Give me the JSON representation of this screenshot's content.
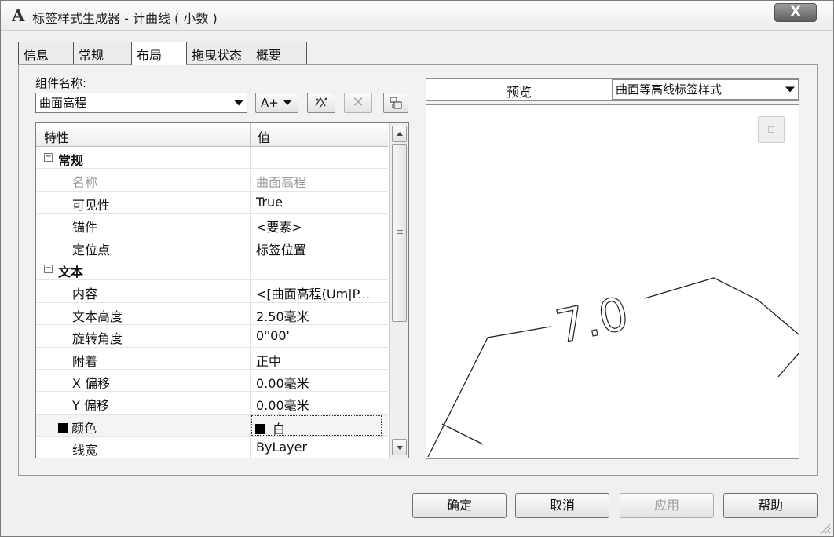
{
  "window": {
    "title": "标签样式生成器 - 计曲线 ( 小数 )",
    "close_label": "X"
  },
  "tabs": [
    {
      "label": "信息"
    },
    {
      "label": "常规"
    },
    {
      "label": "布局",
      "active": true
    },
    {
      "label": "拖曳状态"
    },
    {
      "label": "概要"
    }
  ],
  "component": {
    "label": "组件名称:",
    "selected": "曲面高程",
    "add_component_label": "A+"
  },
  "grid": {
    "headers": {
      "property": "特性",
      "value": "值"
    },
    "categories": {
      "general": "常规",
      "text": "文本"
    },
    "rows": [
      {
        "name": "名称",
        "value": "曲面高程"
      },
      {
        "name": "可见性",
        "value": "True"
      },
      {
        "name": "锚件",
        "value": "<要素>"
      },
      {
        "name": "定位点",
        "value": "标签位置"
      },
      {
        "name": "内容",
        "value": "<[曲面高程(Um|P..."
      },
      {
        "name": "文本高度",
        "value": "2.50毫米"
      },
      {
        "name": "旋转角度",
        "value": "0°00'"
      },
      {
        "name": "附着",
        "value": "正中"
      },
      {
        "name": "X 偏移",
        "value": "0.00毫米"
      },
      {
        "name": "Y 偏移",
        "value": "0.00毫米"
      },
      {
        "name": "颜色",
        "value": "白"
      },
      {
        "name": "线宽",
        "value": "ByLayer"
      }
    ]
  },
  "preview": {
    "label": "预览",
    "style_selected": "曲面等高线标签样式",
    "label_text": "7.0"
  },
  "buttons": {
    "ok": "确定",
    "cancel": "取消",
    "apply": "应用",
    "help": "帮助"
  },
  "icons": {
    "app": "autocad-a-icon",
    "add_component": "add-text-component-icon",
    "copy": "copy-component-icon",
    "delete": "delete-component-icon",
    "order": "component-draw-order-icon"
  },
  "colors": {
    "swatch": "#000000"
  }
}
